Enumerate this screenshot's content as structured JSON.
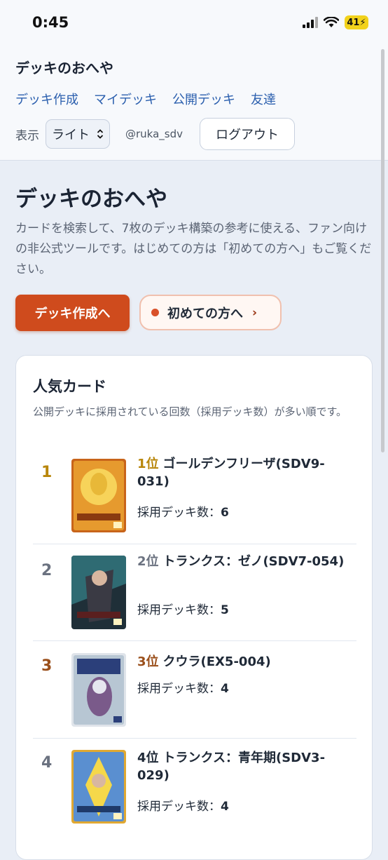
{
  "status": {
    "time": "0:45",
    "battery": "41"
  },
  "header": {
    "title": "デッキのおへや",
    "nav": [
      "デッキ作成",
      "マイデッキ",
      "公開デッキ",
      "友達"
    ],
    "display_label": "表示",
    "theme_value": "ライト",
    "username": "@ruka_sdv",
    "logout_label": "ログアウト"
  },
  "hero": {
    "title": "デッキのおへや",
    "description": "カードを検索して、7枚のデッキ構築の参考に使える、ファン向けの非公式ツールです。はじめての方は「初めての方へ」もご覧ください。",
    "primary_button": "デッキ作成へ",
    "secondary_button": "初めての方へ"
  },
  "popular": {
    "title": "人気カード",
    "description": "公開デッキに採用されている回数（採用デッキ数）が多い順です。",
    "count_label": "採用デッキ数：",
    "items": [
      {
        "rank": "1",
        "rank_label": "1位",
        "name": "ゴールデンフリーザ(SDV9-031)",
        "count": "6"
      },
      {
        "rank": "2",
        "rank_label": "2位",
        "name": "トランクス：ゼノ(SDV7-054)",
        "count": "5"
      },
      {
        "rank": "3",
        "rank_label": "3位",
        "name": "クウラ(EX5-004)",
        "count": "4"
      },
      {
        "rank": "4",
        "rank_label": "4位",
        "name": "トランクス：青年期(SDV3-029)",
        "count": "4"
      }
    ]
  },
  "colors": {
    "accent": "#cf4b1d",
    "link": "#2b5fae",
    "rank1": "#b8860b",
    "rank2": "#6b7280",
    "rank3": "#9a4f1b",
    "rank4": "#6b7280"
  }
}
